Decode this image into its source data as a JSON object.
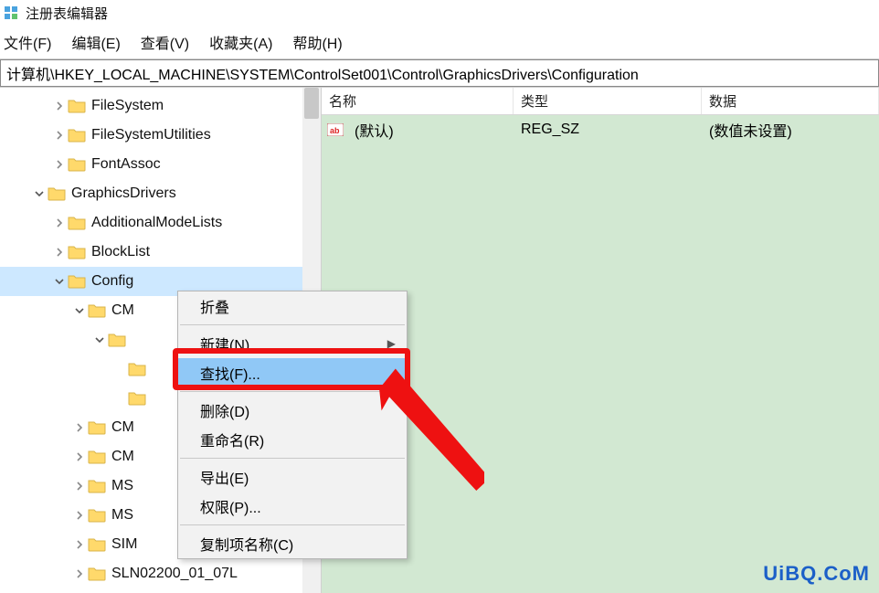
{
  "window": {
    "title": "注册表编辑器"
  },
  "menu": {
    "file": "文件(F)",
    "edit": "编辑(E)",
    "view": "查看(V)",
    "fav": "收藏夹(A)",
    "help": "帮助(H)"
  },
  "address": {
    "path": "计算机\\HKEY_LOCAL_MACHINE\\SYSTEM\\ControlSet001\\Control\\GraphicsDrivers\\Configuration"
  },
  "tree": {
    "items": [
      {
        "label": "FileSystem",
        "exp": "closed",
        "depth": 1
      },
      {
        "label": "FileSystemUtilities",
        "exp": "closed",
        "depth": 1
      },
      {
        "label": "FontAssoc",
        "exp": "closed",
        "depth": 1
      },
      {
        "label": "GraphicsDrivers",
        "exp": "open",
        "depth": 0
      },
      {
        "label": "AdditionalModeLists",
        "exp": "closed",
        "depth": 1
      },
      {
        "label": "BlockList",
        "exp": "closed",
        "depth": 1
      },
      {
        "label": "Config",
        "exp": "open",
        "depth": 1,
        "sel": true,
        "partial": true
      },
      {
        "label": "CM",
        "exp": "open",
        "depth": 2,
        "partial": true
      },
      {
        "label": "",
        "exp": "open",
        "depth": 3,
        "noicon": false
      },
      {
        "label": "",
        "exp": "none",
        "depth": 4
      },
      {
        "label": "",
        "exp": "none",
        "depth": 4
      },
      {
        "label": "CM",
        "exp": "closed",
        "depth": 2,
        "partial": true
      },
      {
        "label": "CM",
        "exp": "closed",
        "depth": 2,
        "partial": true
      },
      {
        "label": "MS",
        "exp": "closed",
        "depth": 2,
        "partial": true
      },
      {
        "label": "MS",
        "exp": "closed",
        "depth": 2,
        "partial": true
      },
      {
        "label": "SIM",
        "exp": "closed",
        "depth": 2,
        "partial": true
      },
      {
        "label": "SLN02200_01_07L",
        "exp": "closed",
        "depth": 2,
        "partial": true
      }
    ]
  },
  "list": {
    "cols": {
      "name": "名称",
      "type": "类型",
      "data": "数据"
    },
    "rows": [
      {
        "name": "(默认)",
        "type": "REG_SZ",
        "data": "(数值未设置)"
      }
    ]
  },
  "context_menu": {
    "collapse": "折叠",
    "new": "新建(N)",
    "find": "查找(F)...",
    "delete": "删除(D)",
    "rename": "重命名(R)",
    "export": "导出(E)",
    "permissions": "权限(P)...",
    "copy_key_name": "复制项名称(C)"
  },
  "watermark": {
    "text": "UiBQ.CoM"
  }
}
